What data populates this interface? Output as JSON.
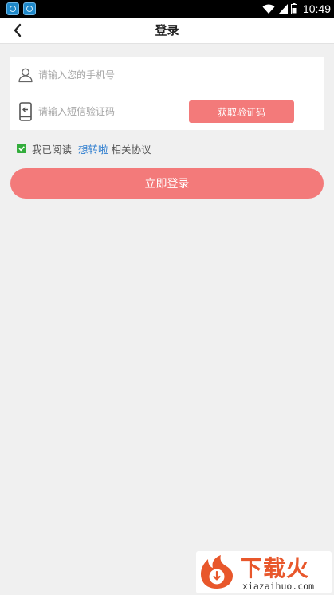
{
  "status_bar": {
    "time": "10:49",
    "app_icons": [
      "app-icon",
      "app-icon"
    ]
  },
  "header": {
    "title": "登录"
  },
  "form": {
    "phone_placeholder": "请输入您的手机号",
    "phone_value": "",
    "code_placeholder": "请输入短信验证码",
    "code_value": "",
    "get_code_label": "获取验证码"
  },
  "agreement": {
    "checked": true,
    "prefix": "我已阅读",
    "link": "想转啦",
    "suffix": "相关协议"
  },
  "login_button_label": "立即登录",
  "watermark": {
    "brand": "下载火",
    "url": "xiazaihuo.com"
  },
  "colors": {
    "accent": "#f37a7a",
    "link": "#2f7ecf",
    "checkbox": "#33ad3c",
    "watermark": "#e8572b"
  }
}
